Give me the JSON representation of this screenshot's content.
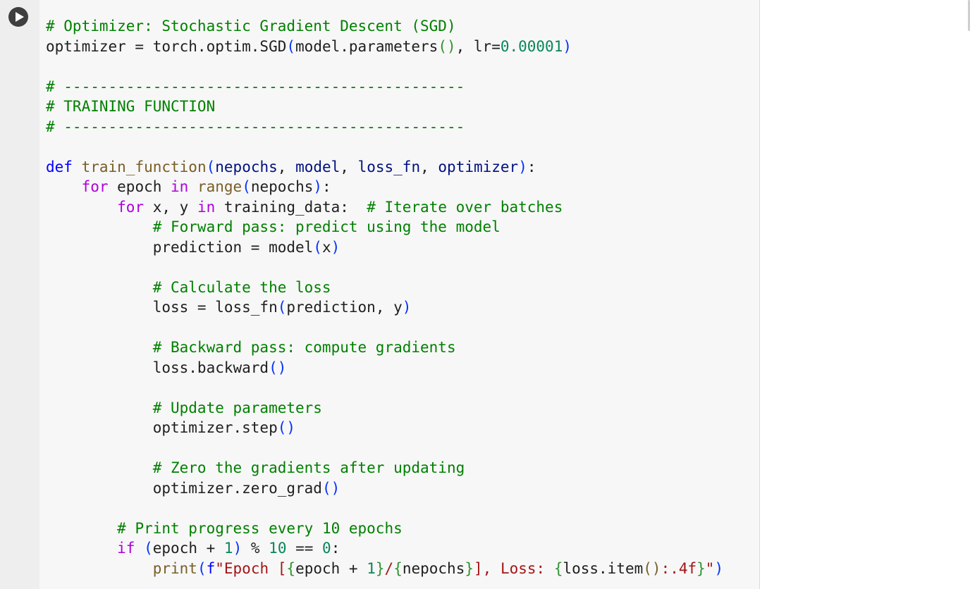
{
  "cell": {
    "run_button_icon": "play-icon",
    "lines": [
      {
        "segs": [
          [
            "c",
            "# Optimizer: Stochastic Gradient Descent (SGD)"
          ]
        ]
      },
      {
        "segs": [
          [
            "",
            "optimizer = torch.optim.SGD"
          ],
          [
            "br",
            "("
          ],
          [
            "",
            "model.parameters"
          ],
          [
            "pn",
            "()"
          ],
          [
            "",
            ", lr="
          ],
          [
            "num",
            "0.00001"
          ],
          [
            "br",
            ")"
          ]
        ]
      },
      {
        "segs": []
      },
      {
        "segs": [
          [
            "c",
            "# ---------------------------------------------"
          ]
        ]
      },
      {
        "segs": [
          [
            "c",
            "# TRAINING FUNCTION"
          ]
        ]
      },
      {
        "segs": [
          [
            "c",
            "# ---------------------------------------------"
          ]
        ]
      },
      {
        "segs": []
      },
      {
        "segs": [
          [
            "kw",
            "def"
          ],
          [
            "",
            " "
          ],
          [
            "fn",
            "train_function"
          ],
          [
            "br",
            "("
          ],
          [
            "pr",
            "nepochs"
          ],
          [
            "",
            ", "
          ],
          [
            "pr",
            "model"
          ],
          [
            "",
            ", "
          ],
          [
            "pr",
            "loss_fn"
          ],
          [
            "",
            ", "
          ],
          [
            "pr",
            "optimizer"
          ],
          [
            "br",
            ")"
          ],
          [
            "",
            ":"
          ]
        ]
      },
      {
        "segs": [
          [
            "",
            "    "
          ],
          [
            "ctl",
            "for"
          ],
          [
            "",
            " epoch "
          ],
          [
            "ctl",
            "in"
          ],
          [
            "",
            " "
          ],
          [
            "fn",
            "range"
          ],
          [
            "br",
            "("
          ],
          [
            "",
            "nepochs"
          ],
          [
            "br",
            ")"
          ],
          [
            "",
            ":"
          ]
        ]
      },
      {
        "segs": [
          [
            "",
            "        "
          ],
          [
            "ctl",
            "for"
          ],
          [
            "",
            " x, y "
          ],
          [
            "ctl",
            "in"
          ],
          [
            "",
            " training_data:  "
          ],
          [
            "c",
            "# Iterate over batches"
          ]
        ]
      },
      {
        "segs": [
          [
            "",
            "            "
          ],
          [
            "c",
            "# Forward pass: predict using the model"
          ]
        ]
      },
      {
        "segs": [
          [
            "",
            "            prediction = model"
          ],
          [
            "br",
            "("
          ],
          [
            "",
            "x"
          ],
          [
            "br",
            ")"
          ]
        ]
      },
      {
        "segs": []
      },
      {
        "segs": [
          [
            "",
            "            "
          ],
          [
            "c",
            "# Calculate the loss"
          ]
        ]
      },
      {
        "segs": [
          [
            "",
            "            loss = loss_fn"
          ],
          [
            "br",
            "("
          ],
          [
            "",
            "prediction, y"
          ],
          [
            "br",
            ")"
          ]
        ]
      },
      {
        "segs": []
      },
      {
        "segs": [
          [
            "",
            "            "
          ],
          [
            "c",
            "# Backward pass: compute gradients"
          ]
        ]
      },
      {
        "segs": [
          [
            "",
            "            loss.backward"
          ],
          [
            "br",
            "()"
          ]
        ]
      },
      {
        "segs": []
      },
      {
        "segs": [
          [
            "",
            "            "
          ],
          [
            "c",
            "# Update parameters"
          ]
        ]
      },
      {
        "segs": [
          [
            "",
            "            optimizer.step"
          ],
          [
            "br",
            "()"
          ]
        ]
      },
      {
        "segs": []
      },
      {
        "segs": [
          [
            "",
            "            "
          ],
          [
            "c",
            "# Zero the gradients after updating"
          ]
        ]
      },
      {
        "segs": [
          [
            "",
            "            optimizer.zero_grad"
          ],
          [
            "br",
            "()"
          ]
        ]
      },
      {
        "segs": []
      },
      {
        "segs": [
          [
            "",
            "        "
          ],
          [
            "c",
            "# Print progress every 10 epochs"
          ]
        ]
      },
      {
        "segs": [
          [
            "",
            "        "
          ],
          [
            "ctl",
            "if"
          ],
          [
            "",
            " "
          ],
          [
            "br",
            "("
          ],
          [
            "",
            "epoch + "
          ],
          [
            "num",
            "1"
          ],
          [
            "br",
            ")"
          ],
          [
            "",
            " % "
          ],
          [
            "num",
            "10"
          ],
          [
            "",
            " == "
          ],
          [
            "num",
            "0"
          ],
          [
            "",
            ":"
          ]
        ]
      },
      {
        "segs": [
          [
            "",
            "            "
          ],
          [
            "fn",
            "print"
          ],
          [
            "br",
            "("
          ],
          [
            "kw",
            "f"
          ],
          [
            "str",
            "\"Epoch ["
          ],
          [
            "pn",
            "{"
          ],
          [
            "",
            "epoch + "
          ],
          [
            "num",
            "1"
          ],
          [
            "pn",
            "}"
          ],
          [
            "str",
            "/"
          ],
          [
            "pn",
            "{"
          ],
          [
            "",
            "nepochs"
          ],
          [
            "pn",
            "}"
          ],
          [
            "str",
            "], Loss: "
          ],
          [
            "pn",
            "{"
          ],
          [
            "",
            "loss.item"
          ],
          [
            "fn",
            "()"
          ],
          [
            "str",
            ":.4f"
          ],
          [
            "pn",
            "}"
          ],
          [
            "str",
            "\""
          ],
          [
            "br",
            ")"
          ]
        ]
      }
    ]
  },
  "colors": {
    "comment": "#008000",
    "keyword": "#0000ff",
    "function": "#795e26",
    "param": "#001080",
    "control": "#af00db",
    "number": "#098658",
    "string": "#a31515",
    "bracket": "#0431fa",
    "cell_bg": "#f7f7f7",
    "gutter_bg": "#eeeeee"
  }
}
